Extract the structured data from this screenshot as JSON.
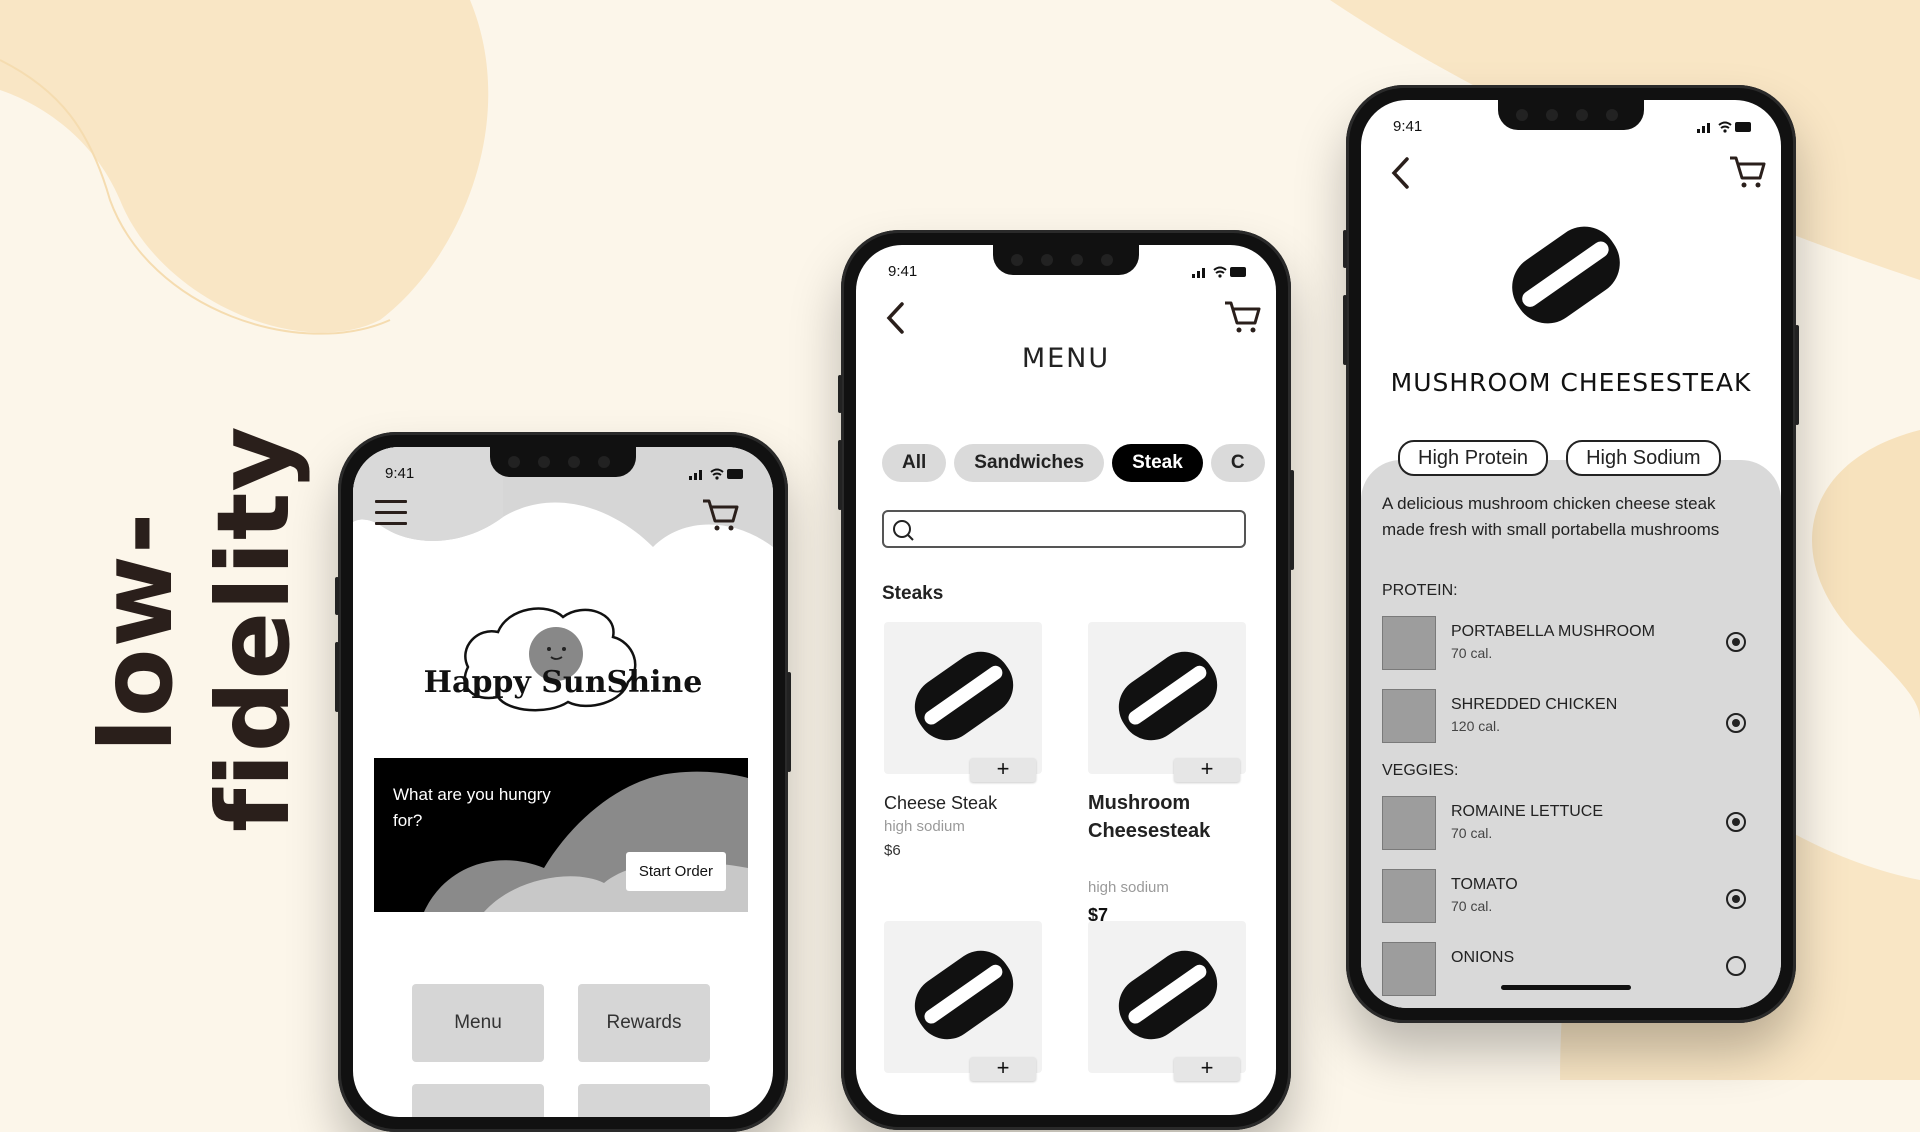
{
  "page": {
    "side_title": "low-fidelity"
  },
  "status": {
    "time": "9:41"
  },
  "home": {
    "logo_text": "Happy SunShine",
    "promo_text": "What are you hungry for?",
    "promo_button": "Start Order",
    "tiles": [
      "Menu",
      "Rewards"
    ]
  },
  "menu": {
    "title": "MENU",
    "chips": [
      "All",
      "Sandwiches",
      "Steak",
      "C"
    ],
    "active_chip": "Steak",
    "search_placeholder": "",
    "section": "Steaks",
    "items": [
      {
        "name": "Cheese Steak",
        "note": "high sodium",
        "price": "$6"
      },
      {
        "name": "Mushroom Cheesesteak",
        "note": "high sodium",
        "price": "$7"
      }
    ],
    "add_symbol": "+"
  },
  "detail": {
    "title": "MUSHROOM CHEESESTEAK",
    "tags": [
      "High Protein",
      "High Sodium"
    ],
    "description": "A delicious mushroom chicken cheese steak made fresh with small portabella mushrooms",
    "protein_label": "PROTEIN:",
    "protein": [
      {
        "name": "PORTABELLA MUSHROOM",
        "cal": "70 cal.",
        "selected": true
      },
      {
        "name": "SHREDDED CHICKEN",
        "cal": "120 cal.",
        "selected": true
      }
    ],
    "veggies_label": "VEGGIES:",
    "veggies": [
      {
        "name": "ROMAINE LETTUCE",
        "cal": "70 cal.",
        "selected": true
      },
      {
        "name": "TOMATO",
        "cal": "70 cal.",
        "selected": true
      },
      {
        "name": "ONIONS",
        "cal": "",
        "selected": false
      }
    ]
  },
  "colors": {
    "background": "#fcf6ea",
    "blob": "#f9e6c5",
    "ink": "#2a1f1b"
  }
}
